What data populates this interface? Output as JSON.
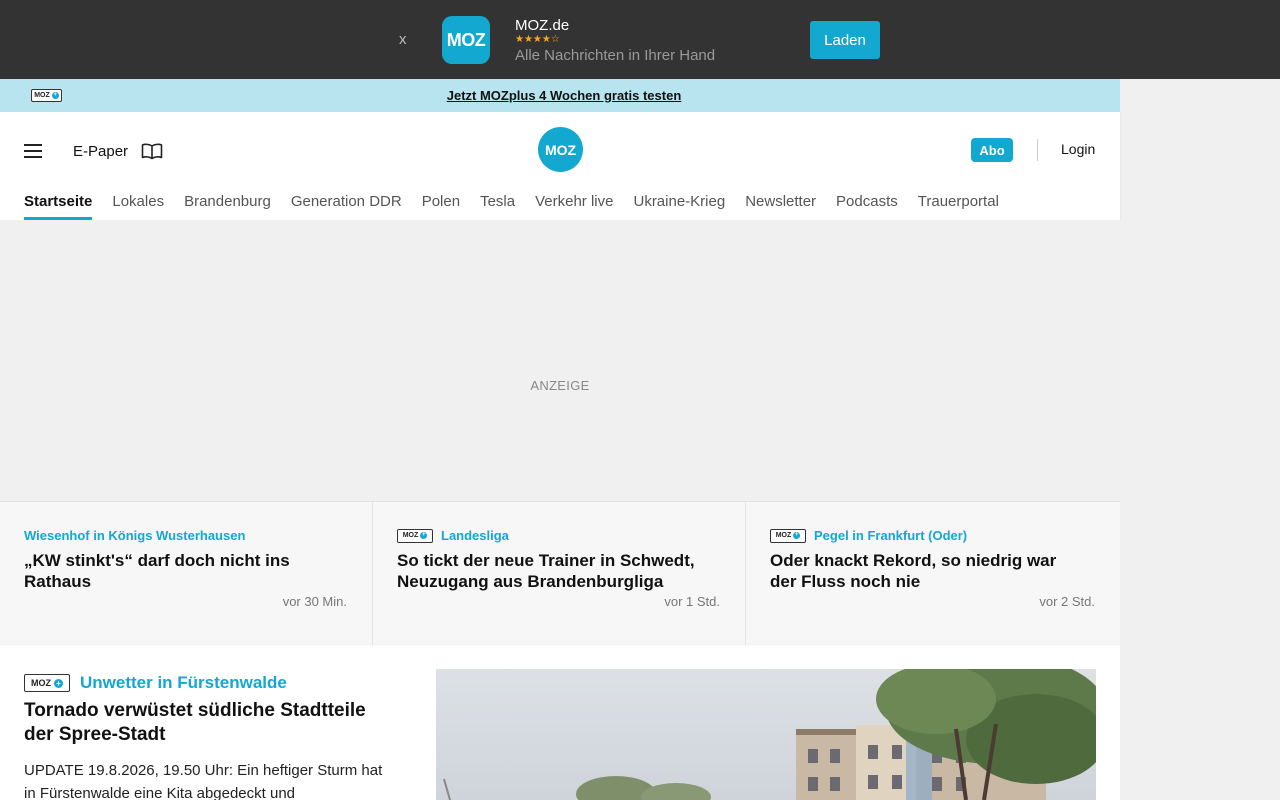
{
  "app_banner": {
    "close_label": "x",
    "logo_text": "MOZ",
    "app_name": "MOZ.de",
    "rating_stars": "★★★★☆",
    "tagline": "Alle Nachrichten in Ihrer Hand",
    "install_label": "Laden"
  },
  "promo": {
    "badge_text": "MOZ",
    "badge_plus": "+",
    "link_text": "Jetzt MOZplus 4 Wochen gratis testen"
  },
  "header": {
    "epaper_label": "E-Paper",
    "logo_text": "MOZ",
    "abo_label": "Abo",
    "login_label": "Login"
  },
  "nav": {
    "items": [
      "Startseite",
      "Lokales",
      "Brandenburg",
      "Generation DDR",
      "Polen",
      "Tesla",
      "Verkehr live",
      "Ukraine-Krieg",
      "Newsletter",
      "Podcasts",
      "Trauerportal"
    ]
  },
  "ad": {
    "label": "ANZEIGE"
  },
  "teasers": [
    {
      "kicker": "Wiesenhof in Königs Wusterhausen",
      "title": "„KW stinkt's“ darf doch nicht ins Rathaus",
      "time": "vor 30 Min.",
      "premium": false
    },
    {
      "kicker": "Landesliga",
      "title": "So tickt der neue Trainer in Schwedt, Neuzugang aus Brandenburgliga",
      "time": "vor 1 Std.",
      "premium": true
    },
    {
      "kicker": "Pegel in Frankfurt (Oder)",
      "title": "Oder knackt Rekord, so niedrig war der Fluss noch nie",
      "time": "vor 2 Std.",
      "premium": true
    }
  ],
  "badge": {
    "text": "MOZ",
    "plus": "+"
  },
  "main_story": {
    "kicker": "Unwetter in Fürstenwalde",
    "title": "Tornado verwüstet südliche Stadtteile der Spree-Stadt",
    "text": "UPDATE 19.8.2026, 19.50 Uhr: Ein heftiger Sturm hat in Fürstenwalde eine Kita abgedeckt und",
    "premium": true
  },
  "colors": {
    "brand": "#13a8cf",
    "banner_bg": "#333333",
    "promo_bg": "#b8e4f0"
  }
}
